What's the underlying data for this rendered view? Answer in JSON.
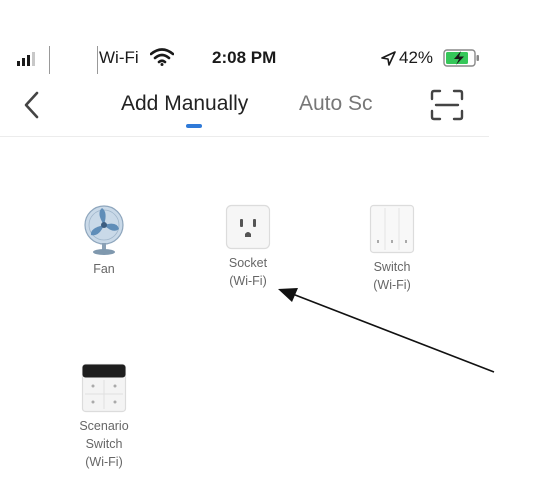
{
  "status_bar": {
    "carrier": "Wi-Fi",
    "time": "2:08 PM",
    "battery_percent": "42%",
    "icons": [
      "signal-icon",
      "wifi-icon",
      "location-icon",
      "battery-charging-icon"
    ]
  },
  "nav": {
    "tabs": [
      {
        "label": "Add Manually",
        "active": true
      },
      {
        "label": "Auto Sc",
        "active": false
      }
    ],
    "icons": [
      "back-icon",
      "scan-icon"
    ],
    "accent_color": "#2f7ad8"
  },
  "devices": [
    {
      "label": "Fan",
      "icon": "fan-icon"
    },
    {
      "label": "Socket\n(Wi-Fi)",
      "icon": "socket-icon"
    },
    {
      "label": "Switch\n(Wi-Fi)",
      "icon": "switch-icon"
    },
    {
      "label": "Scenario\nSwitch\n(Wi-Fi)",
      "icon": "scenario-switch-icon"
    }
  ]
}
